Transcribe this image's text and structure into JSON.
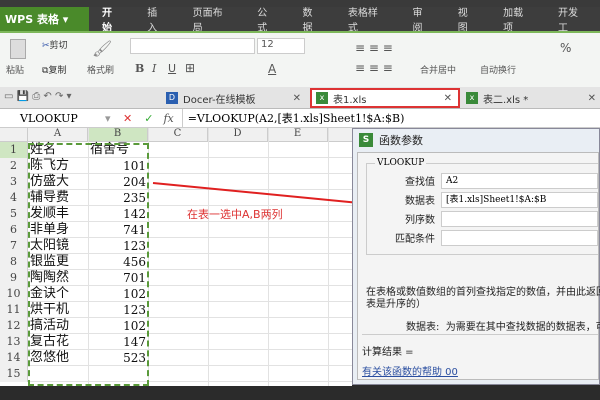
{
  "app": {
    "logo": "WPS 表格"
  },
  "menu": [
    "开始",
    "插入",
    "页面布局",
    "公式",
    "数据",
    "表格样式",
    "审阅",
    "视图",
    "加载项",
    "开发工"
  ],
  "ribbon": {
    "paste": "粘贴",
    "cut": "剪切",
    "copy": "复制",
    "format_painter": "格式刷",
    "font_size": "12",
    "bold": "B",
    "italic": "I",
    "underline": "U",
    "merge": "合并居中",
    "wrap": "自动换行",
    "percent": "%"
  },
  "tabs": [
    {
      "label": "Docer-在线模板"
    },
    {
      "label": "表1.xls"
    },
    {
      "label": "表二.xls *"
    }
  ],
  "formula": {
    "name_box": "VLOOKUP",
    "fx": "fx",
    "content": "=VLOOKUP(A2,[表1.xls]Sheet1!$A:$B)"
  },
  "columns": [
    "A",
    "B",
    "C",
    "D",
    "E"
  ],
  "rows": [
    {
      "n": "1",
      "a": "姓名",
      "b": "宿舍号"
    },
    {
      "n": "2",
      "a": "陈飞方",
      "b": "101"
    },
    {
      "n": "3",
      "a": "仿盛大",
      "b": "204"
    },
    {
      "n": "4",
      "a": "辅导费",
      "b": "235"
    },
    {
      "n": "5",
      "a": "发顺丰",
      "b": "142"
    },
    {
      "n": "6",
      "a": "非单身",
      "b": "741"
    },
    {
      "n": "7",
      "a": "太阳镜",
      "b": "123"
    },
    {
      "n": "8",
      "a": "银监更",
      "b": "456"
    },
    {
      "n": "9",
      "a": "陶陶然",
      "b": "701"
    },
    {
      "n": "10",
      "a": "金诀个",
      "b": "102"
    },
    {
      "n": "11",
      "a": "烘干机",
      "b": "123"
    },
    {
      "n": "12",
      "a": "搞活动",
      "b": "102"
    },
    {
      "n": "13",
      "a": "复古花",
      "b": "147"
    },
    {
      "n": "14",
      "a": "忽悠他",
      "b": "523"
    },
    {
      "n": "15",
      "a": "",
      "b": ""
    }
  ],
  "annotation": "在表一选中A,B两列",
  "dialog": {
    "title": "函数参数",
    "group": "VLOOKUP",
    "fields": [
      {
        "label": "查找值",
        "value": "A2"
      },
      {
        "label": "数据表",
        "value": "[表1.xls]Sheet1!$A:$B"
      },
      {
        "label": "列序数",
        "value": ""
      },
      {
        "label": "匹配条件",
        "value": ""
      }
    ],
    "desc1": "在表格或数值数组的首列查找指定的数值，并由此返回",
    "desc2": "表是升序的）",
    "arg_label": "数据表:",
    "arg_desc": "为需要在其中查找数据的数据表，可",
    "result": "计算结果 =",
    "help": "有关该函数的帮助 00"
  }
}
